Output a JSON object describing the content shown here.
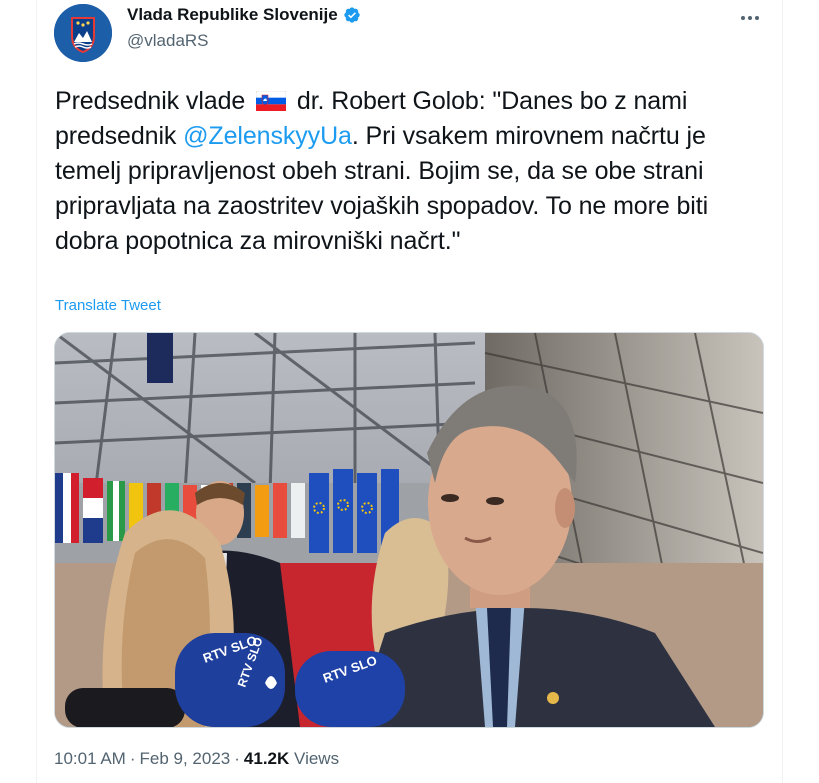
{
  "account": {
    "display_name": "Vlada Republike Slovenije",
    "handle": "@vladaRS",
    "verified_icon": "verified-badge",
    "brand_color": "#1d5ea8"
  },
  "tweet": {
    "part1": "Predsednik vlade",
    "part2": " dr. Robert Golob: \"Danes bo z nami predsednik ",
    "mention": "@ZelenskyyUa",
    "part3": ". Pri vsakem mirovnem načrtu je temelj pripravljenost obeh strani. Bojim se, da se obe strani pripravljata na zaostritev vojaških spopadov. To ne more biti dobra popotnica za mirovniški načrt.\"",
    "flag_icon": "slovenia-flag"
  },
  "translate_label": "Translate Tweet",
  "media": {
    "mic_labels": [
      "RTV SLO",
      "RTV SLO",
      "RTV SLO"
    ]
  },
  "meta": {
    "time": "10:01 AM",
    "sep": "·",
    "date": "Feb 9, 2023",
    "views_count": "41.2K",
    "views_label": "Views"
  },
  "colors": {
    "link": "#1d9bf0",
    "muted": "#536471"
  }
}
